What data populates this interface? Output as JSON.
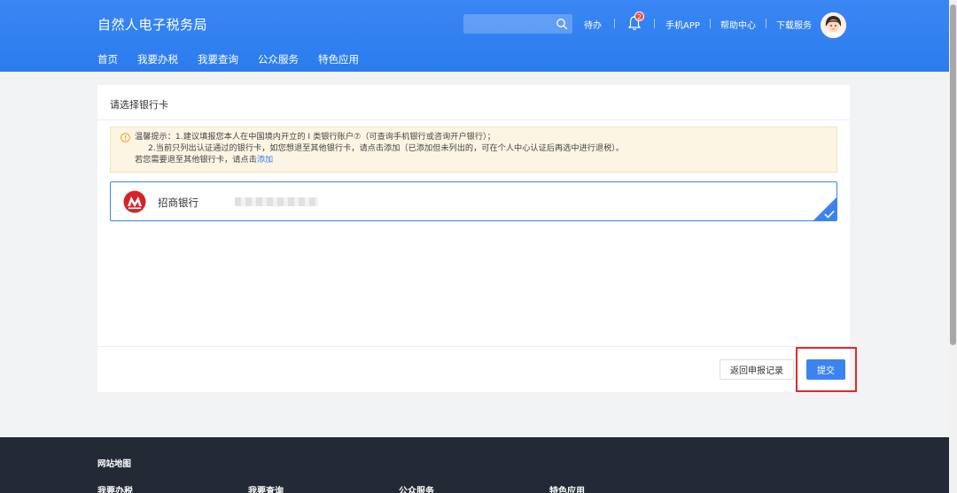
{
  "header": {
    "logo": "自然人电子税务局",
    "search": {
      "value": "",
      "placeholder": ""
    },
    "links": {
      "todo": "待办",
      "notification_count": "2",
      "mobile_app": "手机APP",
      "help": "帮助中心",
      "download": "下载服务"
    },
    "nav": [
      "首页",
      "我要办税",
      "我要查询",
      "公众服务",
      "特色应用"
    ]
  },
  "card": {
    "title": "请选择银行卡",
    "notice": {
      "line1": "温馨提示：1.建议填报您本人在中国境内开立的 I 类银行账户⑦（可查询手机银行或咨询开户银行）；",
      "line2": "2.当前只列出认证通过的银行卡，如您想退至其他银行卡，请点击添加（已添加但未列出的，可在个人中心认证后再选中进行退税）。",
      "line3_prefix": "若您需要退至其他银行卡，请点击",
      "line3_link": "添加"
    },
    "bank": {
      "name": "招商银行",
      "selected": true
    },
    "buttons": {
      "back": "返回申报记录",
      "submit": "提交"
    }
  },
  "footer": {
    "site_map": "网站地图",
    "columns": [
      "我要办税",
      "我要查询",
      "公众服务",
      "特色应用"
    ]
  },
  "colors": {
    "primary": "#2f80f0",
    "highlight": "#e02a2a",
    "notice_bg": "#fdf5e4",
    "footer_bg": "#232a36"
  }
}
